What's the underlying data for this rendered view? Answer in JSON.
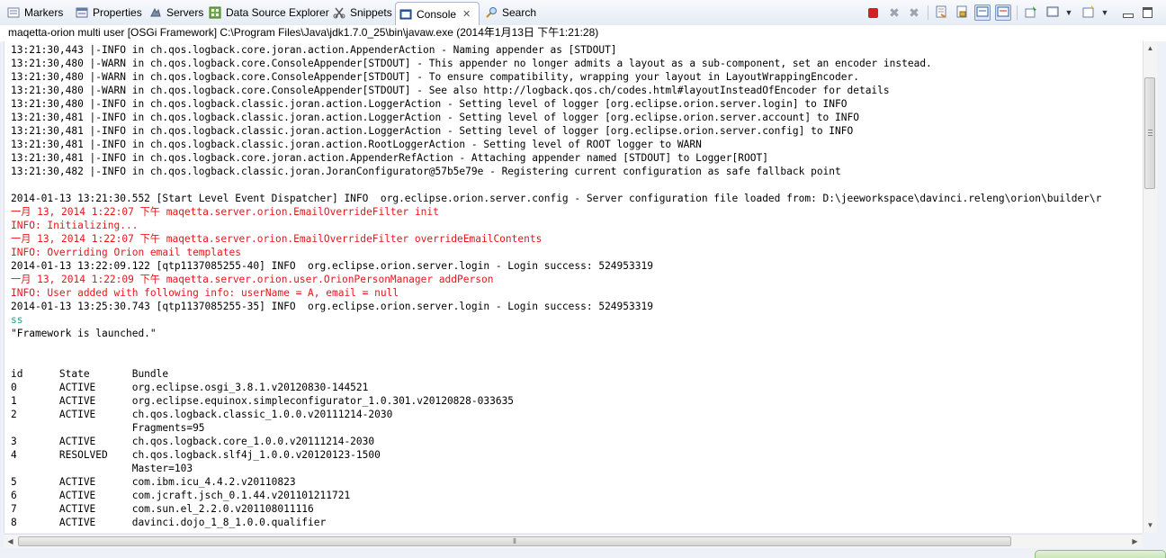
{
  "tabs": [
    {
      "label": "Markers",
      "icon": "markers-icon"
    },
    {
      "label": "Properties",
      "icon": "properties-icon"
    },
    {
      "label": "Servers",
      "icon": "servers-icon"
    },
    {
      "label": "Data Source Explorer",
      "icon": "data-source-explorer-icon"
    },
    {
      "label": "Snippets",
      "icon": "snippets-icon"
    },
    {
      "label": "Console",
      "icon": "console-icon",
      "active": true
    },
    {
      "label": "Search",
      "icon": "search-icon"
    }
  ],
  "toolbar_icons": [
    "terminate-icon",
    "remove-launch-icon",
    "remove-all-terminated-icon",
    "clear-console-icon",
    "scroll-lock-icon",
    "show-on-stdout-icon",
    "show-on-stderr-icon",
    "pin-console-icon",
    "display-selected-console-icon",
    "chevron-down-icon",
    "open-console-icon",
    "chevron-down-icon",
    "minimize-icon",
    "maximize-icon"
  ],
  "colors": {
    "error_text": "#e8151b",
    "echo_text": "#1c9f86",
    "terminate": "#d42020"
  },
  "console": {
    "title": "maqetta-orion multi user [OSGi Framework] C:\\Program Files\\Java\\jdk1.7.0_25\\bin\\javaw.exe (2014年1月13日 下午1:21:28)",
    "lines": [
      {
        "text": "13:21:30,443 |-INFO in ch.qos.logback.core.joran.action.AppenderAction - Naming appender as [STDOUT]",
        "style": "normal"
      },
      {
        "text": "13:21:30,480 |-WARN in ch.qos.logback.core.ConsoleAppender[STDOUT] - This appender no longer admits a layout as a sub-component, set an encoder instead.",
        "style": "normal"
      },
      {
        "text": "13:21:30,480 |-WARN in ch.qos.logback.core.ConsoleAppender[STDOUT] - To ensure compatibility, wrapping your layout in LayoutWrappingEncoder.",
        "style": "normal"
      },
      {
        "text": "13:21:30,480 |-WARN in ch.qos.logback.core.ConsoleAppender[STDOUT] - See also http://logback.qos.ch/codes.html#layoutInsteadOfEncoder for details",
        "style": "normal"
      },
      {
        "text": "13:21:30,480 |-INFO in ch.qos.logback.classic.joran.action.LoggerAction - Setting level of logger [org.eclipse.orion.server.login] to INFO",
        "style": "normal"
      },
      {
        "text": "13:21:30,481 |-INFO in ch.qos.logback.classic.joran.action.LoggerAction - Setting level of logger [org.eclipse.orion.server.account] to INFO",
        "style": "normal"
      },
      {
        "text": "13:21:30,481 |-INFO in ch.qos.logback.classic.joran.action.LoggerAction - Setting level of logger [org.eclipse.orion.server.config] to INFO",
        "style": "normal"
      },
      {
        "text": "13:21:30,481 |-INFO in ch.qos.logback.classic.joran.action.RootLoggerAction - Setting level of ROOT logger to WARN",
        "style": "normal"
      },
      {
        "text": "13:21:30,481 |-INFO in ch.qos.logback.core.joran.action.AppenderRefAction - Attaching appender named [STDOUT] to Logger[ROOT]",
        "style": "normal"
      },
      {
        "text": "13:21:30,482 |-INFO in ch.qos.logback.classic.joran.JoranConfigurator@57b5e79e - Registering current configuration as safe fallback point",
        "style": "normal"
      },
      {
        "text": "",
        "style": "normal"
      },
      {
        "text": "2014-01-13 13:21:30.552 [Start Level Event Dispatcher] INFO  org.eclipse.orion.server.config - Server configuration file loaded from: D:\\jeeworkspace\\davinci.releng\\orion\\builder\\r",
        "style": "normal"
      },
      {
        "text": "一月 13, 2014 1:22:07 下午 maqetta.server.orion.EmailOverrideFilter init",
        "style": "error"
      },
      {
        "text": "INFO: Initializing...",
        "style": "error"
      },
      {
        "text": "一月 13, 2014 1:22:07 下午 maqetta.server.orion.EmailOverrideFilter overrideEmailContents",
        "style": "error"
      },
      {
        "text": "INFO: Overriding Orion email templates",
        "style": "error"
      },
      {
        "text": "2014-01-13 13:22:09.122 [qtp1137085255-40] INFO  org.eclipse.orion.server.login - Login success: 524953319",
        "style": "normal"
      },
      {
        "text": "一月 13, 2014 1:22:09 下午 maqetta.server.orion.user.OrionPersonManager addPerson",
        "style": "error"
      },
      {
        "text": "INFO: User added with following info: userName = A, email = null",
        "style": "error"
      },
      {
        "text": "2014-01-13 13:25:30.743 [qtp1137085255-35] INFO  org.eclipse.orion.server.login - Login success: 524953319",
        "style": "normal"
      },
      {
        "text": "ss",
        "style": "echo"
      },
      {
        "text": "\"Framework is launched.\"",
        "style": "normal"
      },
      {
        "text": "",
        "style": "normal"
      },
      {
        "text": "",
        "style": "normal"
      },
      {
        "text": "id      State       Bundle",
        "style": "normal"
      },
      {
        "text": "0       ACTIVE      org.eclipse.osgi_3.8.1.v20120830-144521",
        "style": "normal"
      },
      {
        "text": "1       ACTIVE      org.eclipse.equinox.simpleconfigurator_1.0.301.v20120828-033635",
        "style": "normal"
      },
      {
        "text": "2       ACTIVE      ch.qos.logback.classic_1.0.0.v20111214-2030",
        "style": "normal"
      },
      {
        "text": "                    Fragments=95",
        "style": "normal"
      },
      {
        "text": "3       ACTIVE      ch.qos.logback.core_1.0.0.v20111214-2030",
        "style": "normal"
      },
      {
        "text": "4       RESOLVED    ch.qos.logback.slf4j_1.0.0.v20120123-1500",
        "style": "normal"
      },
      {
        "text": "                    Master=103",
        "style": "normal"
      },
      {
        "text": "5       ACTIVE      com.ibm.icu_4.4.2.v20110823",
        "style": "normal"
      },
      {
        "text": "6       ACTIVE      com.jcraft.jsch_0.1.44.v201101211721",
        "style": "normal"
      },
      {
        "text": "7       ACTIVE      com.sun.el_2.2.0.v201108011116",
        "style": "normal"
      },
      {
        "text": "8       ACTIVE      davinci.dojo_1_8_1.0.0.qualifier",
        "style": "normal"
      }
    ]
  }
}
